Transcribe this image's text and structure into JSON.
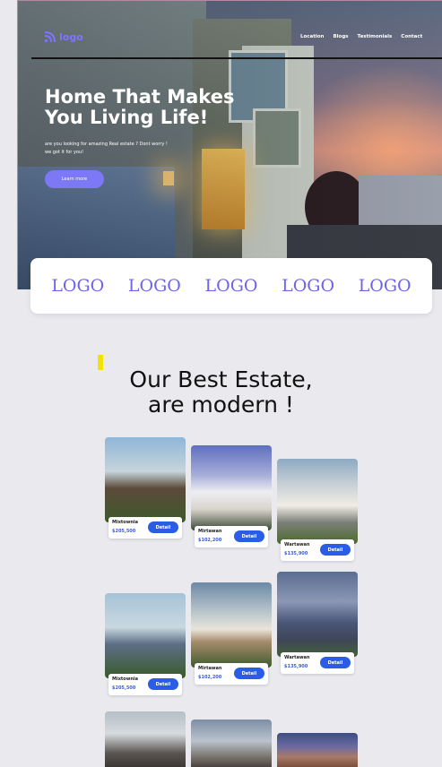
{
  "nav": {
    "logo_text": "logo",
    "links": [
      "Location",
      "Blogs",
      "Testimonials",
      "Contact"
    ]
  },
  "hero": {
    "headline_line1": "Home That Makes",
    "headline_line2": "You Living Life!",
    "subtitle": "are you looking for amazing Real estate ? Dont worry ! we got it for you!",
    "cta_label": "Learn more"
  },
  "partners": [
    "LOGO",
    "LOGO",
    "LOGO",
    "LOGO",
    "LOGO"
  ],
  "section": {
    "title_line1": "Our Best Estate,",
    "title_line2": "are modern !"
  },
  "listings": [
    {
      "name": "Mixtownia",
      "price": "$205,500",
      "button": "Detail"
    },
    {
      "name": "Mirtawan",
      "price": "$102,200",
      "button": "Detail"
    },
    {
      "name": "Wartawan",
      "price": "$135,900",
      "button": "Detail"
    },
    {
      "name": "Mixtownia",
      "price": "$205,500",
      "button": "Detail"
    },
    {
      "name": "Mirtawan",
      "price": "$102,200",
      "button": "Detail"
    },
    {
      "name": "Wartawan",
      "price": "$135,900",
      "button": "Detail"
    }
  ],
  "colors": {
    "accent": "#7d78f5",
    "partner_logo": "#6f63e8",
    "detail_button": "#2a5de3",
    "price": "#3e5ed4",
    "highlight": "#f2e20a"
  }
}
